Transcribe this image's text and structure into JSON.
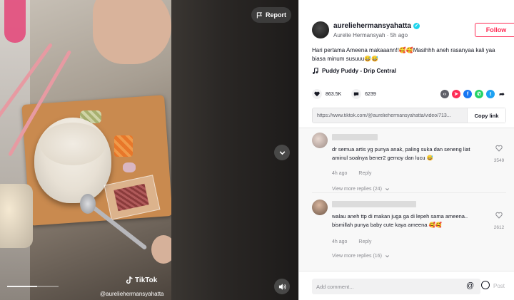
{
  "video": {
    "report_label": "Report",
    "watermark_brand": "TikTok",
    "watermark_user": "@aureliehermansyahatta",
    "progress_fraction": 0.58
  },
  "author": {
    "username": "aureliehermansyahatta",
    "nickname": "Aurelie Hermansyah",
    "time": "5h ago",
    "follow_label": "Follow"
  },
  "caption": "Hari pertama Ameena makaaann!!🥰🥰Masihhh aneh rasanyaa kali yaa biasa minum susuuu😅😅",
  "music": "Puddy Puddy - Drip Central",
  "stats": {
    "likes": "863.5K",
    "comments": "6239"
  },
  "share": {
    "link": "https://www.tiktok.com/@aureliehermansyahatta/video/713...",
    "copy_label": "Copy link"
  },
  "comments": [
    {
      "text": "dr semua artis yg punya anak, paling suka dan seneng liat aminul soalnya bener2 gemoy dan lucu 😅",
      "time": "4h ago",
      "reply_label": "Reply",
      "likes": "3549",
      "more_replies": "View more replies (24)"
    },
    {
      "text": "walau aneh ttp di makan juga ga di lepeh sama ameena..\nbismillah punya baby cute kaya ameena 🥰🥰",
      "time": "4h ago",
      "reply_label": "Reply",
      "likes": "2612",
      "more_replies": "View more replies (16)"
    }
  ],
  "comment_bar": {
    "placeholder": "Add comment...",
    "post_label": "Post"
  },
  "colors": {
    "accent": "#fe2c55",
    "verified": "#20d5ec"
  }
}
